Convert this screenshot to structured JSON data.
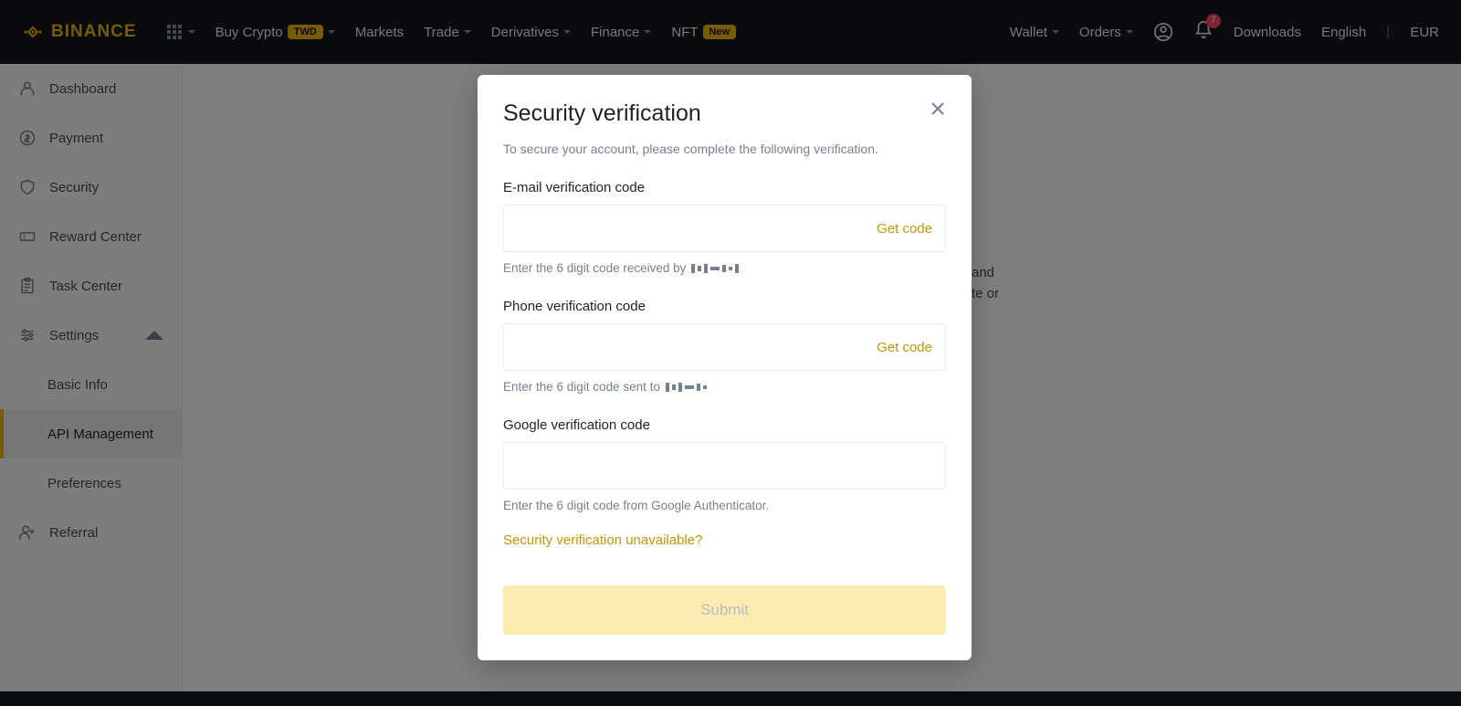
{
  "header": {
    "brand": "BINANCE",
    "buy_crypto": "Buy Crypto",
    "buy_crypto_badge": "TWD",
    "markets": "Markets",
    "trade": "Trade",
    "derivatives": "Derivatives",
    "finance": "Finance",
    "nft": "NFT",
    "nft_badge": "New",
    "wallet": "Wallet",
    "orders": "Orders",
    "downloads": "Downloads",
    "language": "English",
    "currency": "EUR",
    "notif_count": "7"
  },
  "sidebar": {
    "dashboard": "Dashboard",
    "payment": "Payment",
    "security": "Security",
    "reward_center": "Reward Center",
    "task_center": "Task Center",
    "settings": "Settings",
    "basic_info": "Basic Info",
    "api_management": "API Management",
    "preferences": "Preferences",
    "referral": "Referral"
  },
  "bg": {
    "line1": "and",
    "line2": "te or"
  },
  "modal": {
    "title": "Security verification",
    "desc": "To secure your account, please complete the following verification.",
    "email_label": "E-mail verification code",
    "email_get": "Get code",
    "email_hint": "Enter the 6 digit code received by",
    "phone_label": "Phone verification code",
    "phone_get": "Get code",
    "phone_hint": "Enter the 6 digit code sent to",
    "google_label": "Google verification code",
    "google_hint": "Enter the 6 digit code from Google Authenticator.",
    "unavailable": "Security verification unavailable?",
    "submit": "Submit"
  }
}
